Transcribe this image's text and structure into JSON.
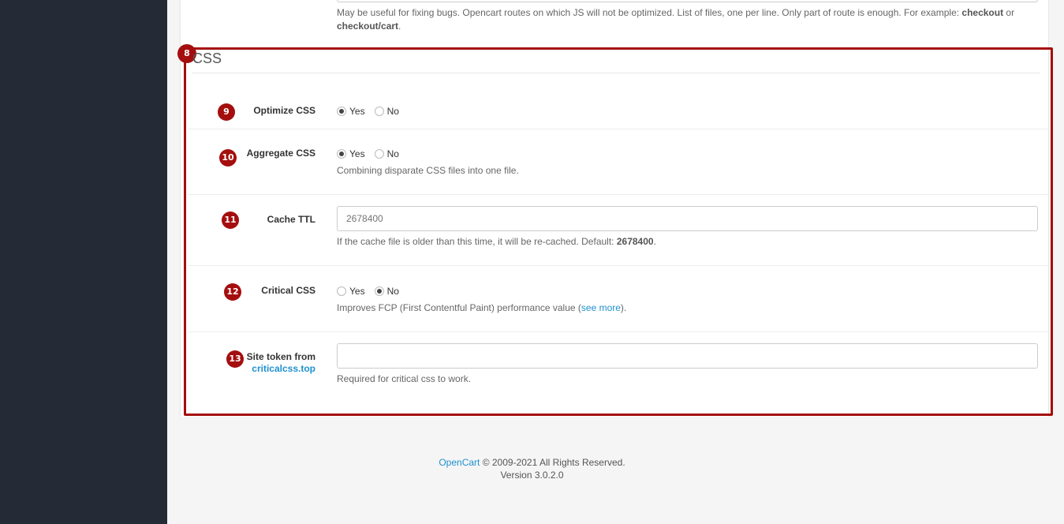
{
  "top_help": {
    "text": "May be useful for fixing bugs. Opencart routes on which JS will not be optimized. List of files, one per line. Only part of route is enough. For example: ",
    "example1": "checkout",
    "or": " or ",
    "example2": "checkout/cart",
    "end": "."
  },
  "section": {
    "badge": "8",
    "legend": "CSS"
  },
  "fields": {
    "optimize": {
      "badge": "9",
      "label": "Optimize CSS",
      "yes": "Yes",
      "no": "No",
      "selected": "Yes"
    },
    "aggregate": {
      "badge": "10",
      "label": "Aggregate CSS",
      "yes": "Yes",
      "no": "No",
      "selected": "Yes",
      "help": "Combining disparate CSS files into one file."
    },
    "cache_ttl": {
      "badge": "11",
      "label": "Cache TTL",
      "placeholder": "2678400",
      "help_text": "If the cache file is older than this time, it will be re-cached. Default: ",
      "help_default": "2678400",
      "help_end": "."
    },
    "critical": {
      "badge": "12",
      "label": "Critical CSS",
      "yes": "Yes",
      "no": "No",
      "selected": "No",
      "help_text": "Improves FCP (First Contentful Paint) performance value (",
      "help_link": "see more",
      "help_end": ")."
    },
    "token": {
      "badge": "13",
      "label_line1": "Site token from",
      "label_link": "criticalcss.top",
      "value": "",
      "help": "Required for critical css to work."
    }
  },
  "footer": {
    "brand": "OpenCart",
    "copyright": " © 2009-2021 All Rights Reserved.",
    "version": "Version 3.0.2.0"
  },
  "colors": {
    "accent": "#a50e0e",
    "link": "#1e91cf",
    "sidebar": "#242a36"
  }
}
